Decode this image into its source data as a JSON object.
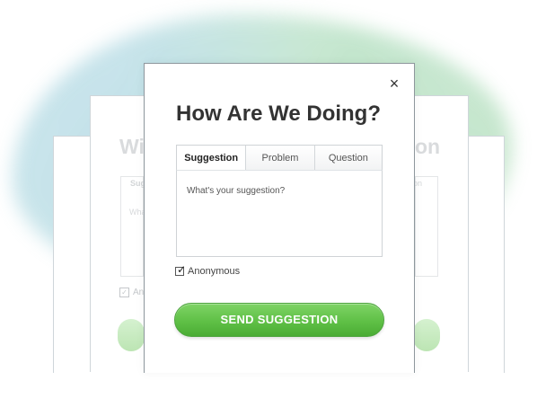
{
  "background": {
    "left_title_fragment": "Wi",
    "right_title_fragment": "on",
    "left_tab_fragment": "Sug",
    "right_tab_fragment": "on",
    "left_placeholder_fragment": "Wha",
    "left_checkbox_fragment": "An"
  },
  "dialog": {
    "close_symbol": "×",
    "title": "How Are We Doing?",
    "tabs": [
      {
        "label": "Suggestion",
        "active": true
      },
      {
        "label": "Problem",
        "active": false
      },
      {
        "label": "Question",
        "active": false
      }
    ],
    "textarea": {
      "placeholder": "What's your suggestion?",
      "value": ""
    },
    "anonymous": {
      "label": "Anonymous",
      "checked": true
    },
    "submit_label": "SEND SUGGESTION"
  },
  "colors": {
    "button_green": "#5fc046",
    "text_dark": "#333333",
    "card_border": "#8e979d"
  },
  "icons": {
    "close": "close-icon",
    "checkbox": "checkmark-icon"
  }
}
